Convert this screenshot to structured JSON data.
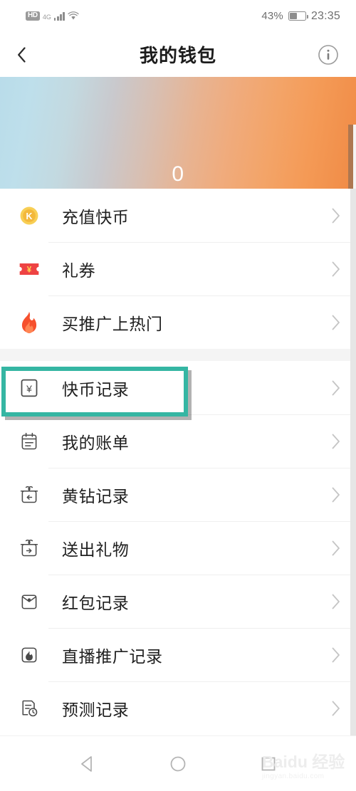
{
  "status_bar": {
    "hd_label": "HD",
    "network_label": "4G",
    "signal_icon": "signal-bars-icon",
    "wifi_icon": "wifi-icon",
    "battery_percent": "43%",
    "battery_icon": "battery-icon",
    "time": "23:35"
  },
  "header": {
    "back_icon": "chevron-left-icon",
    "title": "我的钱包",
    "info_icon": "info-circle-icon"
  },
  "banner": {
    "amount": "0",
    "gradient_start": "#b9dcea",
    "gradient_end": "#f08a45",
    "edge_strip_color": "#ae7750"
  },
  "sections": [
    {
      "items": [
        {
          "label": "充值快币",
          "icon": "coin-k-icon",
          "icon_color": "#f5c13a",
          "chevron": "chevron-right-icon",
          "highlighted": false
        },
        {
          "label": "礼券",
          "icon": "ticket-yen-icon",
          "icon_color": "#ed4040",
          "chevron": "chevron-right-icon",
          "highlighted": false
        },
        {
          "label": "买推广上热门",
          "icon": "flame-icon",
          "icon_color": "#f6502d",
          "chevron": "chevron-right-icon",
          "highlighted": false
        }
      ]
    },
    {
      "items": [
        {
          "label": "快币记录",
          "icon": "yen-box-icon",
          "icon_color": "#4a4a4a",
          "chevron": "chevron-right-icon",
          "highlighted": true
        },
        {
          "label": "我的账单",
          "icon": "calendar-bill-icon",
          "icon_color": "#4a4a4a",
          "chevron": "chevron-right-icon",
          "highlighted": false
        },
        {
          "label": "黄钻记录",
          "icon": "gift-in-icon",
          "icon_color": "#4a4a4a",
          "chevron": "chevron-right-icon",
          "highlighted": false
        },
        {
          "label": "送出礼物",
          "icon": "gift-out-icon",
          "icon_color": "#4a4a4a",
          "chevron": "chevron-right-icon",
          "highlighted": false
        },
        {
          "label": "红包记录",
          "icon": "red-envelope-icon",
          "icon_color": "#4a4a4a",
          "chevron": "chevron-right-icon",
          "highlighted": false
        },
        {
          "label": "直播推广记录",
          "icon": "promo-flame-box-icon",
          "icon_color": "#4a4a4a",
          "chevron": "chevron-right-icon",
          "highlighted": false
        },
        {
          "label": "预测记录",
          "icon": "forecast-clock-icon",
          "icon_color": "#4a4a4a",
          "chevron": "chevron-right-icon",
          "highlighted": false
        }
      ]
    }
  ],
  "highlight": {
    "color": "#35b6a3",
    "target_label": "快币记录"
  },
  "nav_bar": {
    "back_icon": "nav-back-triangle-icon",
    "home_icon": "nav-home-circle-icon",
    "recents_icon": "nav-recents-square-icon"
  },
  "watermark": {
    "main": "Baidu 经验",
    "sub": "jingyan.baidu.com"
  }
}
